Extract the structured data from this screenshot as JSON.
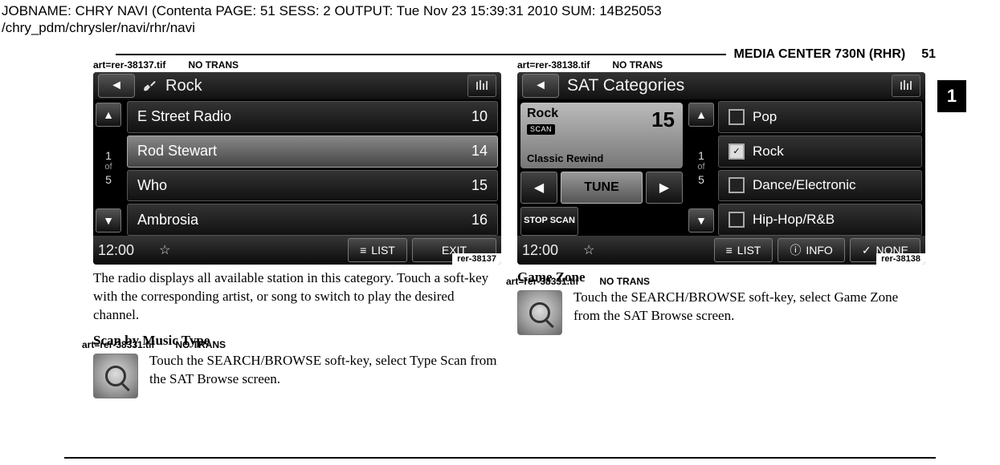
{
  "meta": {
    "line1": "JOBNAME: CHRY NAVI (Contenta   PAGE: 51  SESS: 2  OUTPUT: Tue Nov 23 15:39:31 2010  SUM: 14B25053",
    "line2": "/chry_pdm/chrysler/navi/rhr/navi"
  },
  "header": {
    "title": "MEDIA CENTER 730N (RHR)",
    "page_num": "51",
    "tab": "1"
  },
  "left": {
    "art_ref": "art=rer-38137.tif",
    "no_trans": "NO TRANS",
    "screen": {
      "title": "Rock",
      "pager_top": "1",
      "pager_of": "of",
      "pager_bot": "5",
      "rows": [
        {
          "name": "E Street Radio",
          "ch": "10",
          "sel": false
        },
        {
          "name": "Rod Stewart",
          "ch": "14",
          "sel": true
        },
        {
          "name": "Who",
          "ch": "15",
          "sel": false
        },
        {
          "name": "Ambrosia",
          "ch": "16",
          "sel": false
        }
      ],
      "clock": "12:00",
      "list_btn": "LIST",
      "exit_btn": "EXIT",
      "tag": "rer-38137"
    },
    "para": "The radio displays all available station in this category. Touch a soft-key with the corresponding artist, or song to switch to play the desired channel.",
    "sect_title": "Scan by Music Type",
    "sect_art_ref": "art=rer-38331.tif",
    "sect_no_trans": "NO TRANS",
    "sect_para": "Touch the SEARCH/BROWSE soft-key, select Type Scan from the SAT Browse screen."
  },
  "right": {
    "art_ref": "art=rer-38138.tif",
    "no_trans": "NO TRANS",
    "screen": {
      "title": "SAT Categories",
      "card_name": "Rock",
      "card_scan": "SCAN",
      "card_ch": "15",
      "card_sub": "Classic Rewind",
      "tune": "TUNE",
      "stop_scan": "STOP SCAN",
      "pager_top": "1",
      "pager_of": "of",
      "pager_bot": "5",
      "cats": [
        {
          "name": "Pop",
          "checked": false
        },
        {
          "name": "Rock",
          "checked": true
        },
        {
          "name": "Dance/Electronic",
          "checked": false
        },
        {
          "name": "Hip-Hop/R&B",
          "checked": false
        }
      ],
      "clock": "12:00",
      "list_btn": "LIST",
      "info_btn": "INFO",
      "none_btn": "NONE",
      "tag": "rer-38138"
    },
    "sect_title": "Game Zone",
    "sect_art_ref": "art=rer-38331.tif",
    "sect_no_trans": "NO TRANS",
    "sect_para": "Touch the SEARCH/BROWSE soft-key, select Game Zone from the SAT Browse screen."
  }
}
